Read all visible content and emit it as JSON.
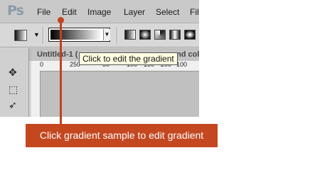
{
  "app": {
    "logo": "Ps"
  },
  "menu": {
    "items": [
      "File",
      "Edit",
      "Image",
      "Layer",
      "Select",
      "Fil"
    ]
  },
  "document": {
    "title_left": "Untitled-1 (",
    "title_right": "nd col"
  },
  "ruler": {
    "labels": [
      "0",
      "250",
      "50",
      "100",
      "150",
      "200",
      "250",
      "100"
    ]
  },
  "tooltip": {
    "text": "Click to edit the gradient"
  },
  "callout": {
    "text": "Click gradient sample to edit gradient"
  },
  "colors": {
    "accent": "#c44720",
    "tooltip_bg": "#ffffe1",
    "menubar": "#c9c9c9"
  },
  "icons": {
    "tool_preset": "gradient-tool-preset-icon",
    "gradient_types": [
      "linear-gradient-icon",
      "radial-gradient-icon",
      "angle-gradient-icon",
      "reflected-gradient-icon",
      "diamond-gradient-icon"
    ],
    "tools": [
      "move-tool-icon",
      "marquee-tool-icon",
      "lasso-tool-icon"
    ]
  }
}
